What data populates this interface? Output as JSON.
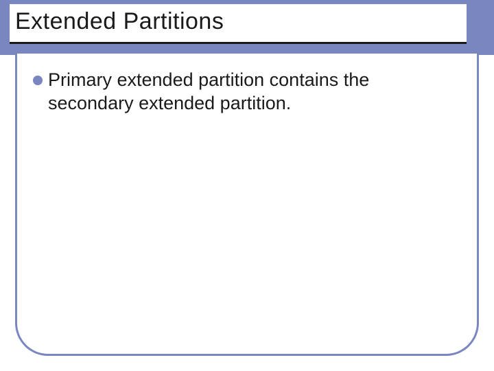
{
  "slide": {
    "title": "Extended Partitions",
    "bullets": [
      {
        "text": "Primary extended partition contains the secondary extended partition."
      }
    ]
  },
  "theme": {
    "accent": "#7a86c0"
  }
}
